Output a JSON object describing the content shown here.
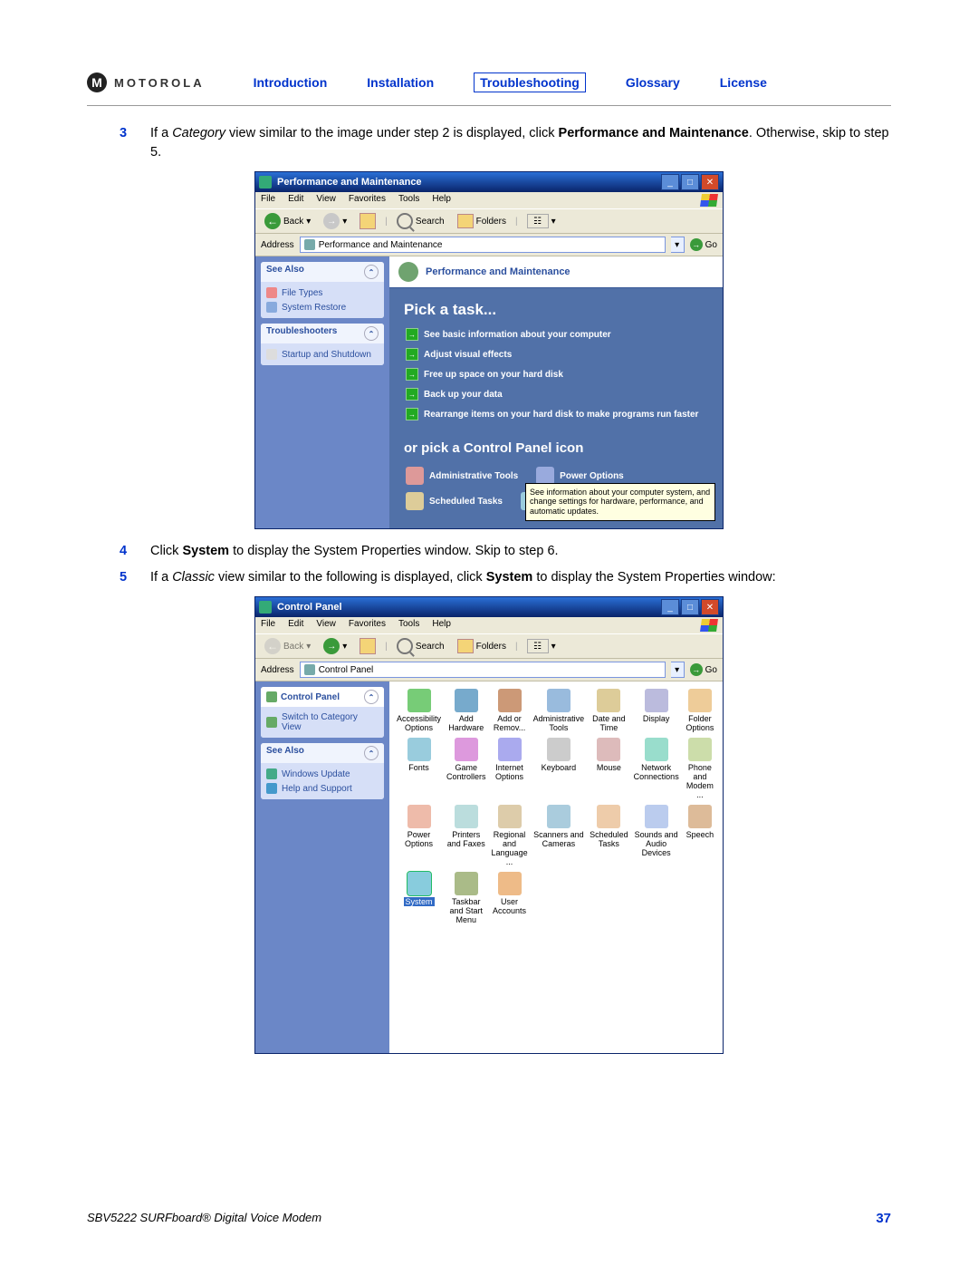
{
  "header": {
    "brand": "MOTOROLA",
    "nav": {
      "intro": "Introduction",
      "install": "Installation",
      "trouble": "Troubleshooting",
      "glossary": "Glossary",
      "license": "License"
    }
  },
  "steps": {
    "s3": {
      "num": "3",
      "pre": "If a ",
      "cat": "Category",
      "mid": " view similar to the image under step 2 is displayed, click ",
      "bold": "Performance and Maintenance",
      "post": ". Otherwise, skip to step 5."
    },
    "s4": {
      "num": "4",
      "pre": "Click ",
      "bold": "System",
      "post": " to display the System Properties window. Skip to step 6."
    },
    "s5": {
      "num": "5",
      "pre": "If a ",
      "cat": "Classic",
      "mid": " view similar to the following is displayed, click ",
      "bold": "System",
      "post": " to display the System Properties window:"
    }
  },
  "xp": {
    "menus": {
      "file": "File",
      "edit": "Edit",
      "view": "View",
      "fav": "Favorites",
      "tools": "Tools",
      "help": "Help"
    },
    "toolbar": {
      "back": "Back",
      "search": "Search",
      "folders": "Folders"
    },
    "addr_label": "Address",
    "go": "Go"
  },
  "win1": {
    "title": "Performance and Maintenance",
    "address": "Performance and Maintenance",
    "side": {
      "see_also": "See Also",
      "file_types": "File Types",
      "sys_restore": "System Restore",
      "troubleshooters": "Troubleshooters",
      "startup": "Startup and Shutdown"
    },
    "main": {
      "header": "Performance and Maintenance",
      "pick": "Pick a task...",
      "tasks": {
        "t1": "See basic information about your computer",
        "t2": "Adjust visual effects",
        "t3": "Free up space on your hard disk",
        "t4": "Back up your data",
        "t5": "Rearrange items on your hard disk to make programs run faster"
      },
      "or_pick": "or pick a Control Panel icon",
      "icons": {
        "admin": "Administrative Tools",
        "power": "Power Options",
        "sched": "Scheduled Tasks",
        "system": "System"
      },
      "tooltip": "See information about your computer system, and change settings for hardware, performance, and automatic updates."
    }
  },
  "win2": {
    "title": "Control Panel",
    "address": "Control Panel",
    "side": {
      "cp": "Control Panel",
      "switch": "Switch to Category View",
      "see_also": "See Also",
      "wu": "Windows Update",
      "help": "Help and Support"
    },
    "icons": [
      "Accessibility Options",
      "Add Hardware",
      "Add or Remov...",
      "Administrative Tools",
      "Date and Time",
      "Display",
      "Folder Options",
      "Fonts",
      "Game Controllers",
      "Internet Options",
      "Keyboard",
      "Mouse",
      "Network Connections",
      "Phone and Modem ...",
      "Power Options",
      "Printers and Faxes",
      "Regional and Language ...",
      "Scanners and Cameras",
      "Scheduled Tasks",
      "Sounds and Audio Devices",
      "Speech",
      "System",
      "Taskbar and Start Menu",
      "User Accounts"
    ]
  },
  "footer": {
    "product": "SBV5222 SURFboard® Digital Voice Modem",
    "page": "37"
  }
}
